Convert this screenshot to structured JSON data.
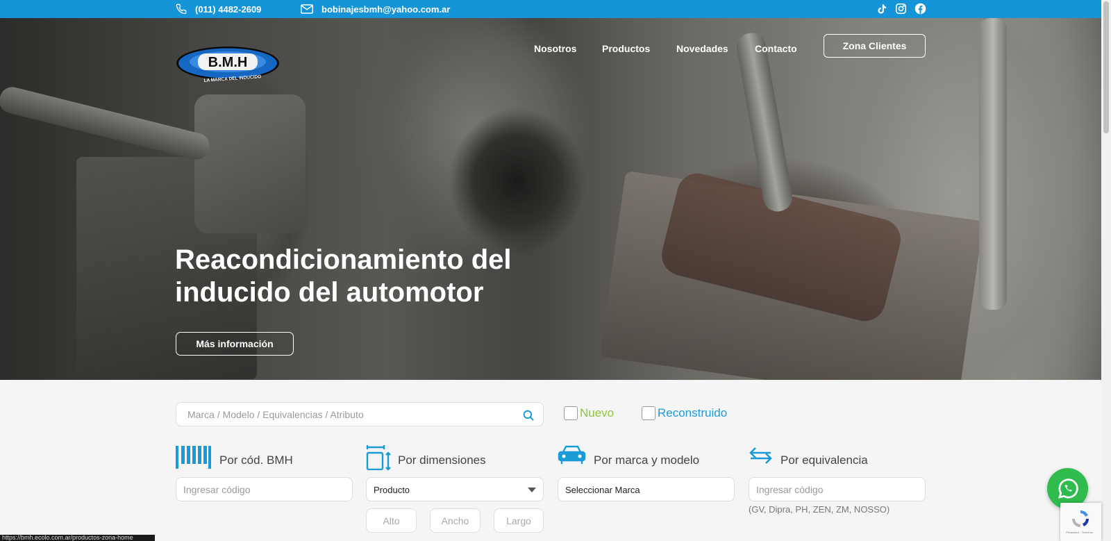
{
  "topbar": {
    "phone": "(011) 4482-2609",
    "email": "bobinajesbmh@yahoo.com.ar",
    "icons": [
      "phone-icon",
      "mail-icon",
      "tiktok-icon",
      "instagram-icon",
      "facebook-icon"
    ],
    "bg_color": "#1595d8"
  },
  "header": {
    "logo_text": "B.M.H",
    "logo_tagline": "LA MARCA DEL INDUCIDO",
    "nav": [
      "Nosotros",
      "Productos",
      "Novedades",
      "Contacto"
    ],
    "cta": "Zona Clientes"
  },
  "hero": {
    "title": "Reacondicionamiento del inducido del automotor",
    "button": "Más información"
  },
  "search": {
    "placeholder": "Marca / Modelo / Equivalencias / Atributo",
    "filters": [
      {
        "label": "Nuevo",
        "checked": false,
        "color": "#8cc43c"
      },
      {
        "label": "Reconstruido",
        "checked": false,
        "color": "#1a9bd7"
      }
    ]
  },
  "categories": {
    "bmh": {
      "title": "Por cód. BMH",
      "placeholder": "Ingresar código"
    },
    "dimensions": {
      "title": "Por dimensiones",
      "select_value": "Producto",
      "fields": [
        "Alto",
        "Ancho",
        "Largo"
      ]
    },
    "brand": {
      "title": "Por marca y modelo",
      "select_value": "Seleccionar Marca"
    },
    "equivalence": {
      "title": "Por equivalencia",
      "placeholder": "Ingresar código",
      "note": "(GV, Dipra, PH, ZEN, ZM, NOSSO)"
    },
    "icon_color": "#1a9bd7"
  },
  "widgets": {
    "whatsapp": "whatsapp-icon",
    "recaptcha_text": "Privacidad - Términos",
    "status_url": "https://bmh.ecolo.com.ar/productos-zona-home"
  }
}
